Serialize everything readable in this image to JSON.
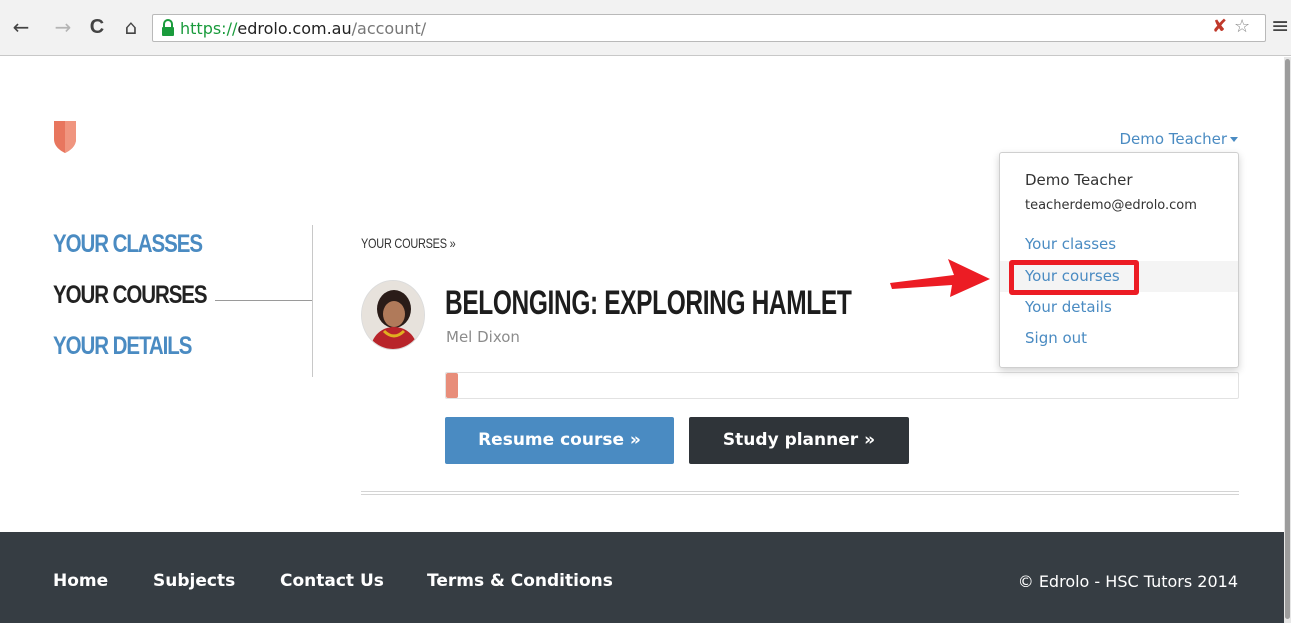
{
  "browser": {
    "url_scheme": "https://",
    "url_host": "edrolo.com.au",
    "url_path": "/account/",
    "back_glyph": "←",
    "forward_glyph": "→",
    "reload_glyph": "C",
    "home_glyph": "⌂",
    "star_glyph": "☆",
    "menu_glyph": "≡",
    "extension_glyph": "✘"
  },
  "header": {
    "user_name": "Demo Teacher"
  },
  "side_nav": {
    "items": [
      {
        "label": "YOUR CLASSES",
        "active": false
      },
      {
        "label": "YOUR COURSES",
        "active": true
      },
      {
        "label": "YOUR DETAILS",
        "active": false
      }
    ]
  },
  "main": {
    "breadcrumb": "YOUR COURSES »",
    "course": {
      "title": "BELONGING: EXPLORING HAMLET",
      "author": "Mel Dixon",
      "progress_fraction": 0.015,
      "resume_label": "Resume course »",
      "planner_label": "Study planner »"
    }
  },
  "dropdown": {
    "name": "Demo Teacher",
    "email": "teacherdemo@edrolo.com",
    "items": [
      {
        "label": "Your classes"
      },
      {
        "label": "Your courses"
      },
      {
        "label": "Your details"
      },
      {
        "label": "Sign out"
      }
    ]
  },
  "footer": {
    "links": [
      "Home",
      "Subjects",
      "Contact Us",
      "Terms & Conditions"
    ],
    "copyright": "© Edrolo - HSC Tutors 2014"
  },
  "colors": {
    "accent": "#4a8bc2",
    "dark_button": "#2f3439",
    "footer_bg": "#363d43",
    "logo": "#e8765e",
    "annotation_red": "#ec1c24"
  }
}
